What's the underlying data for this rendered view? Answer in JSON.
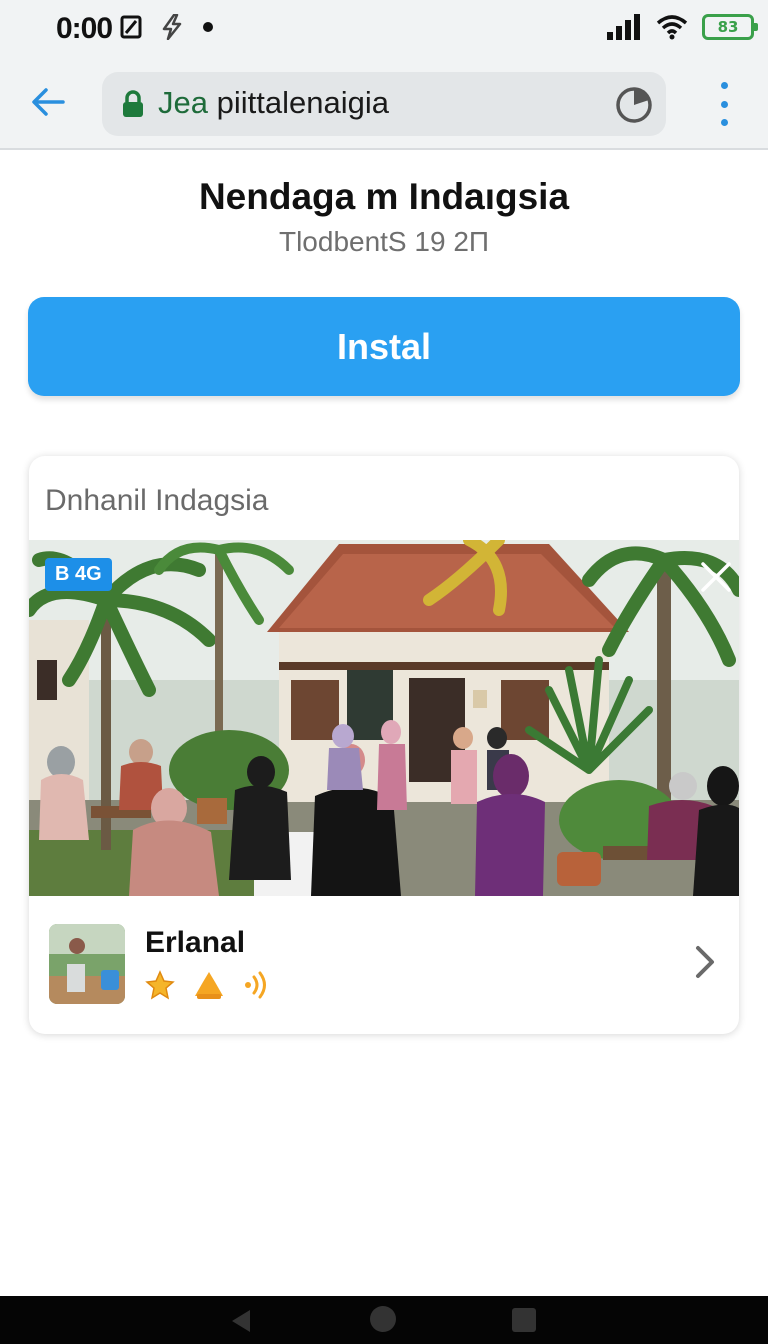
{
  "status_bar": {
    "time": "0:00",
    "left_icons": [
      "screenshot-icon",
      "flash-icon",
      "notification-dot-icon"
    ],
    "right_icons": [
      "signal-icon",
      "wifi-icon",
      "battery-icon"
    ],
    "battery_label": "83"
  },
  "browser": {
    "url_host": "Jea",
    "url_path": " piittalenaigia",
    "back_icon": "back-arrow-icon",
    "lock_icon": "lock-icon",
    "timer_icon": "timer-icon",
    "menu_icon": "overflow-menu-icon"
  },
  "header": {
    "title": "Nendaga m Indaıgsia",
    "subtitle": "TlodbentS 19 2П"
  },
  "install_button": {
    "label": "Instal"
  },
  "card": {
    "title": "Dnhanil Indagsia",
    "image_badge": "B 4G",
    "close_icon": "close-icon",
    "item": {
      "title": "Erlanal",
      "icons": [
        "star-icon",
        "bell-icon",
        "sound-wave-icon"
      ],
      "chevron_icon": "chevron-right-icon"
    }
  },
  "colors": {
    "accent": "#2aa0f2",
    "lock_green": "#1e6b3a",
    "battery_green": "#3aa04a",
    "icon_orange": "#f5a623"
  }
}
